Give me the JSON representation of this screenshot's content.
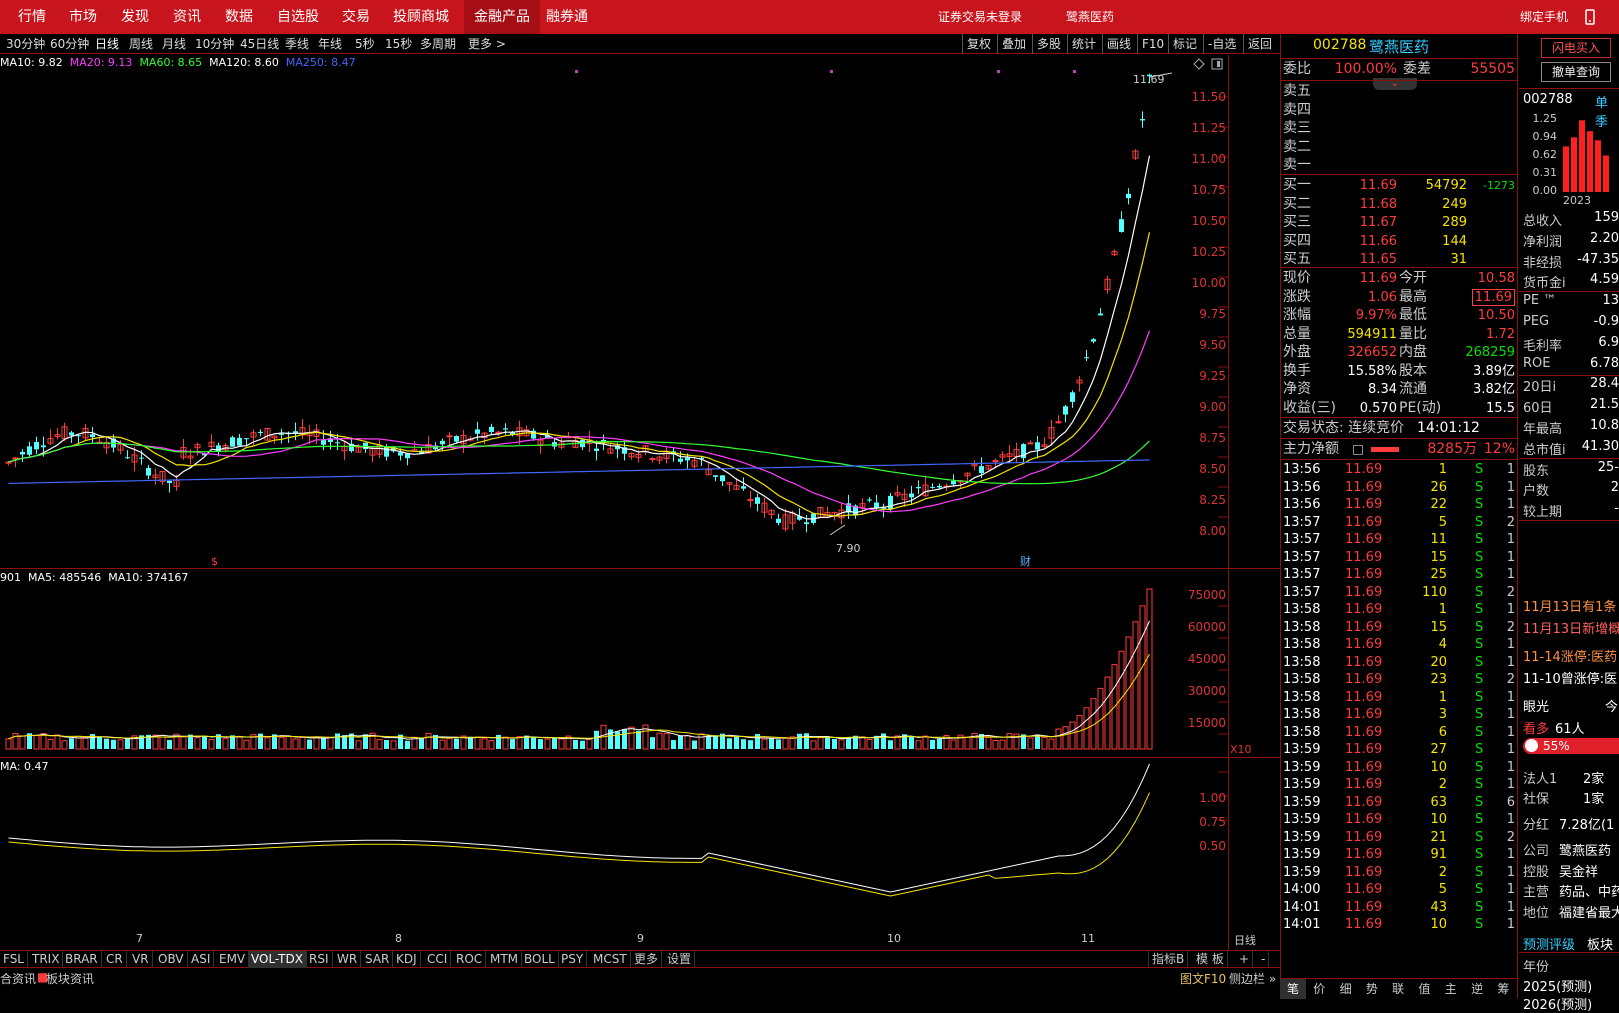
{
  "topnav": [
    "行情",
    "市场",
    "发现",
    "资讯",
    "数据",
    "自选股",
    "交易",
    "投顾商城",
    "金融产品",
    "融券通"
  ],
  "topnav_active": "金融产品",
  "top_status": {
    "login": "证券交易未登录",
    "stock": "鹭燕医药",
    "bind": "绑定手机"
  },
  "periods": [
    "30分钟",
    "60分钟",
    "日线",
    "周线",
    "月线",
    "10分钟",
    "45日线",
    "季线",
    "年线",
    "5秒",
    "15秒",
    "多周期",
    "更多 >"
  ],
  "active_period": "日线",
  "toolbar": [
    "复权",
    "叠加",
    "多股",
    "统计",
    "画线",
    "F10",
    "标记",
    "-自选",
    "返回"
  ],
  "main_legend": [
    {
      "text": "MA10: 9.82",
      "color": "#ffffff"
    },
    {
      "text": "MA20: 9.13",
      "color": "#ff3cff"
    },
    {
      "text": "MA60: 8.65",
      "color": "#33ff33"
    },
    {
      "text": "MA120: 8.60",
      "color": "#ffffff"
    },
    {
      "text": "MA250: 8.47",
      "color": "#4466ff"
    }
  ],
  "price_axis": [
    "11.50",
    "11.25",
    "11.00",
    "10.75",
    "10.50",
    "10.25",
    "10.00",
    "9.75",
    "9.50",
    "9.25",
    "9.00",
    "8.75",
    "8.50",
    "8.25",
    "8.00"
  ],
  "price_hi_label": "11.69",
  "price_lo_label": "7.90",
  "marker_labels": {
    "s": "$",
    "cai": "财"
  },
  "vol_legend": [
    {
      "text": "901",
      "color": "#ffffff"
    },
    {
      "text": "MA5: 485546",
      "color": "#ffffff"
    },
    {
      "text": "MA10: 374167",
      "color": "#ffffff"
    }
  ],
  "vol_axis": [
    "75000",
    "60000",
    "45000",
    "30000",
    "15000"
  ],
  "vol_unit": "X10",
  "ind_legend": "MA: 0.47",
  "ind_axis": [
    "1.00",
    "0.75",
    "0.50"
  ],
  "months": [
    "7",
    "8",
    "9",
    "10",
    "11"
  ],
  "period_label": "日线",
  "indicators": [
    "FSL",
    "TRIX",
    "BRAR",
    "CR",
    "VR",
    "OBV",
    "ASI",
    "EMV",
    "VOL-TDX",
    "RSI",
    "WR",
    "SAR",
    "KDJ",
    "CCI",
    "ROC",
    "MTM",
    "BOLL",
    "PSY",
    "MCST",
    "更多",
    "设置"
  ],
  "indicator_active": "VOL-TDX",
  "indicator_right": [
    "指标B",
    "模 板",
    "+",
    "-"
  ],
  "infobar": {
    "a": "合资讯",
    "b": "板块资讯",
    "c": "图文F10",
    "d": "侧边栏 »"
  },
  "quote": {
    "code": "002788",
    "name": "鹭燕医药",
    "weibi_label": "委比",
    "weibi": "100.00%",
    "weicha_label": "委差",
    "weicha": "55505",
    "sells": [
      "卖五",
      "卖四",
      "卖三",
      "卖二",
      "卖一"
    ],
    "buys": [
      {
        "label": "买一",
        "price": "11.69",
        "vol": "54792",
        "chg": "-1273"
      },
      {
        "label": "买二",
        "price": "11.68",
        "vol": "249",
        "chg": ""
      },
      {
        "label": "买三",
        "price": "11.67",
        "vol": "289",
        "chg": ""
      },
      {
        "label": "买四",
        "price": "11.66",
        "vol": "144",
        "chg": ""
      },
      {
        "label": "买五",
        "price": "11.65",
        "vol": "31",
        "chg": ""
      }
    ],
    "stats": [
      {
        "l1": "现价",
        "v1": "11.69",
        "c1": "red",
        "l2": "今开",
        "v2": "10.58",
        "c2": "red"
      },
      {
        "l1": "涨跌",
        "v1": "1.06",
        "c1": "red",
        "l2": "最高",
        "v2": "11.69",
        "c2": "red"
      },
      {
        "l1": "涨幅",
        "v1": "9.97%",
        "c1": "red",
        "l2": "最低",
        "v2": "10.50",
        "c2": "red"
      },
      {
        "l1": "总量",
        "v1": "594911",
        "c1": "yel",
        "l2": "量比",
        "v2": "1.72",
        "c2": "red"
      },
      {
        "l1": "外盘",
        "v1": "326652",
        "c1": "red",
        "l2": "内盘",
        "v2": "268259",
        "c2": "grn"
      },
      {
        "l1": "换手",
        "v1": "15.58%",
        "c1": "wht",
        "l2": "股本",
        "v2": "3.89亿",
        "c2": "wht"
      },
      {
        "l1": "净资",
        "v1": "8.34",
        "c1": "wht",
        "l2": "流通",
        "v2": "3.82亿",
        "c2": "wht"
      },
      {
        "l1": "收益(三)",
        "v1": "0.570",
        "c1": "wht",
        "l2": "PE(动)",
        "v2": "15.5",
        "c2": "wht"
      }
    ],
    "trade_status_label": "交易状态: 连续竞价",
    "trade_time": "14:01:12",
    "mainforce_label": "主力净额",
    "mainforce_val": "8285万",
    "mainforce_pct": "12%",
    "ticks": [
      [
        "13:56",
        "11.69",
        "1",
        "S",
        "1"
      ],
      [
        "13:56",
        "11.69",
        "26",
        "S",
        "1"
      ],
      [
        "13:56",
        "11.69",
        "22",
        "S",
        "1"
      ],
      [
        "13:57",
        "11.69",
        "5",
        "S",
        "2"
      ],
      [
        "13:57",
        "11.69",
        "11",
        "S",
        "1"
      ],
      [
        "13:57",
        "11.69",
        "15",
        "S",
        "1"
      ],
      [
        "13:57",
        "11.69",
        "25",
        "S",
        "1"
      ],
      [
        "13:57",
        "11.69",
        "110",
        "S",
        "2"
      ],
      [
        "13:58",
        "11.69",
        "1",
        "S",
        "1"
      ],
      [
        "13:58",
        "11.69",
        "15",
        "S",
        "2"
      ],
      [
        "13:58",
        "11.69",
        "4",
        "S",
        "1"
      ],
      [
        "13:58",
        "11.69",
        "20",
        "S",
        "1"
      ],
      [
        "13:58",
        "11.69",
        "23",
        "S",
        "2"
      ],
      [
        "13:58",
        "11.69",
        "1",
        "S",
        "1"
      ],
      [
        "13:58",
        "11.69",
        "3",
        "S",
        "1"
      ],
      [
        "13:58",
        "11.69",
        "6",
        "S",
        "1"
      ],
      [
        "13:59",
        "11.69",
        "27",
        "S",
        "1"
      ],
      [
        "13:59",
        "11.69",
        "10",
        "S",
        "1"
      ],
      [
        "13:59",
        "11.69",
        "2",
        "S",
        "1"
      ],
      [
        "13:59",
        "11.69",
        "63",
        "S",
        "6"
      ],
      [
        "13:59",
        "11.69",
        "10",
        "S",
        "1"
      ],
      [
        "13:59",
        "11.69",
        "21",
        "S",
        "2"
      ],
      [
        "13:59",
        "11.69",
        "91",
        "S",
        "1"
      ],
      [
        "13:59",
        "11.69",
        "2",
        "S",
        "1"
      ],
      [
        "14:00",
        "11.69",
        "5",
        "S",
        "1"
      ],
      [
        "14:01",
        "11.69",
        "43",
        "S",
        "1"
      ],
      [
        "14:01",
        "11.69",
        "10",
        "S",
        "1"
      ]
    ],
    "bottom_tabs": [
      "笔",
      "价",
      "细",
      "势",
      "联",
      "值",
      "主",
      "逆",
      "筹"
    ]
  },
  "far": {
    "btn1": "闪电买入",
    "btn2": "撤单查询",
    "code": "002788",
    "unit": "单季",
    "bar_axis": [
      "1.25",
      "0.94",
      "0.62",
      "0.31",
      "0.00"
    ],
    "bar_year": "2023",
    "bar_values": [
      0.75,
      0.9,
      1.18,
      1.0,
      0.85,
      0.6
    ],
    "fin": [
      {
        "l": "总收入",
        "v": "159"
      },
      {
        "l": "净利润",
        "v": "2.20"
      },
      {
        "l": "非经损",
        "v": "-47.35"
      },
      {
        "l": "货币金i",
        "v": "4.59"
      },
      {
        "l": "PE ™",
        "v": "13"
      },
      {
        "l": "PEG",
        "v": "-0.9"
      },
      {
        "l": "毛利率",
        "v": "6.9"
      },
      {
        "l": "ROE",
        "v": "6.78"
      },
      {
        "l": "20日i",
        "v": "28.4"
      },
      {
        "l": "60日",
        "v": "21.5"
      },
      {
        "l": "年最高",
        "v": "10.8"
      },
      {
        "l": "总市值i",
        "v": "41.30"
      },
      {
        "l": "股东",
        "v": "25-"
      },
      {
        "l": "户数",
        "v": "2"
      },
      {
        "l": "较上期",
        "v": "-"
      }
    ],
    "news": [
      "11月13日有1条",
      "11月13日新增概",
      "11-14涨停:医药",
      "11-10曾涨停:医"
    ],
    "eye_label": "眼光",
    "eye_val": "今",
    "kanduo": "看多",
    "kanduo_n": "61人",
    "kanduo_pct": "55%",
    "org": [
      {
        "l": "法人1",
        "v": "2家"
      },
      {
        "l": "社保",
        "v": "1家"
      }
    ],
    "fenhong_label": "分红",
    "fenhong": "7.28亿(1",
    "company": [
      {
        "l": "公司",
        "v": "鹭燕医药"
      },
      {
        "l": "控股",
        "v": "吴金祥"
      },
      {
        "l": "主营",
        "v": "药品、中药"
      },
      {
        "l": "地位",
        "v": "福建省最大"
      }
    ],
    "pingji": "预测评级",
    "bankuai": "板块",
    "year_label": "年份",
    "years": [
      "2025(预测)",
      "2026(预测)"
    ]
  }
}
